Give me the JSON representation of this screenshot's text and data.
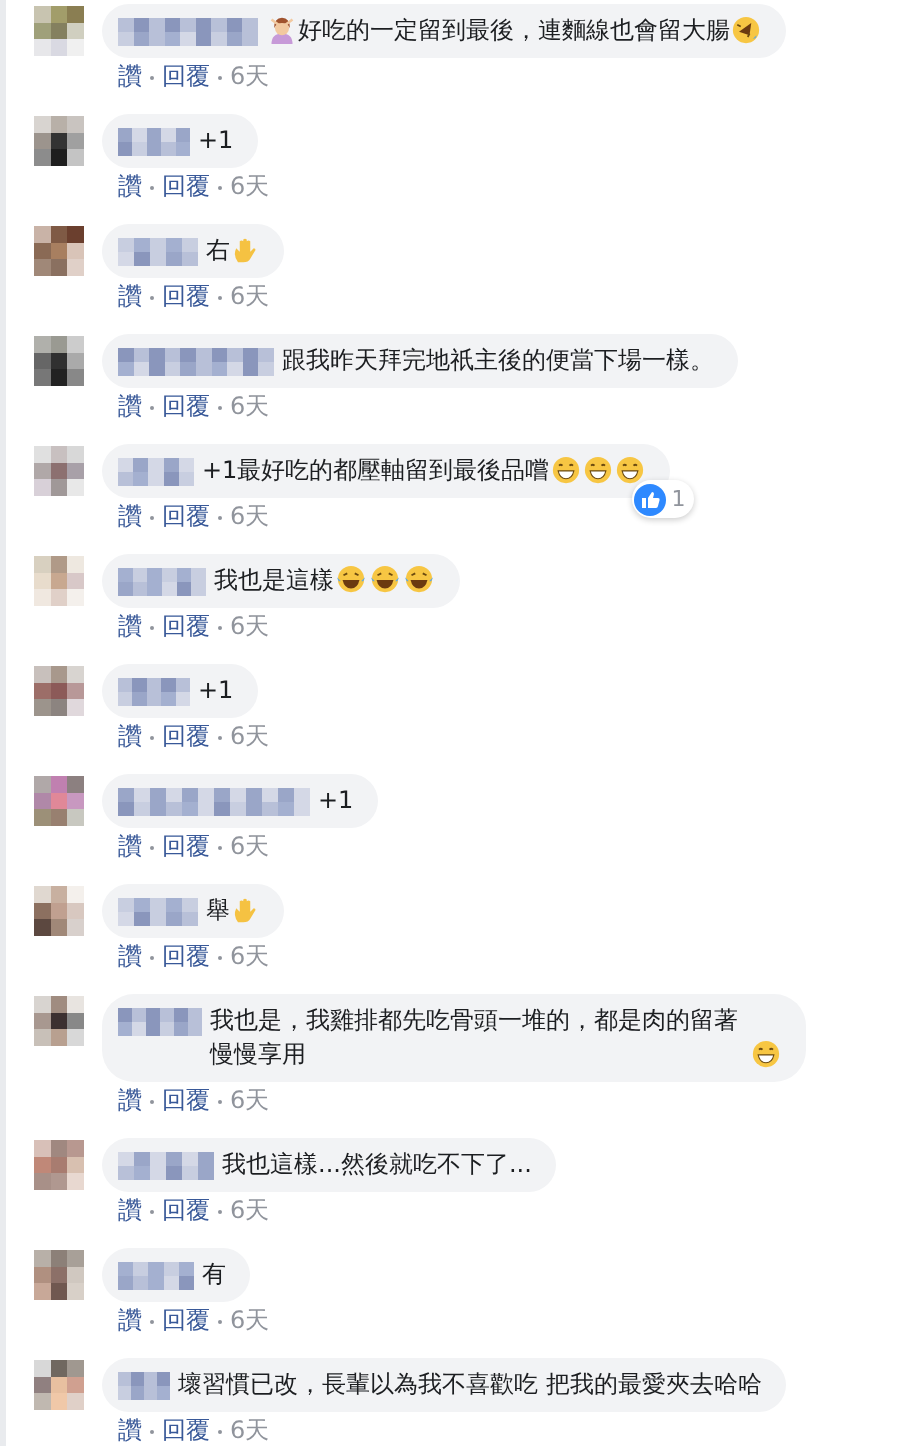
{
  "comments": [
    {
      "parts": [
        {
          "kind": "person"
        },
        {
          "kind": "text",
          "text": "好吃的一定留到最後，連麵線也會留大腸"
        },
        {
          "kind": "rofl"
        }
      ],
      "actions": {
        "like": "讚",
        "reply": "回覆",
        "time": "6天"
      }
    },
    {
      "parts": [
        {
          "kind": "text",
          "text": "+1"
        }
      ],
      "actions": {
        "like": "讚",
        "reply": "回覆",
        "time": "6天"
      }
    },
    {
      "parts": [
        {
          "kind": "text",
          "text": "右"
        },
        {
          "kind": "hand"
        }
      ],
      "actions": {
        "like": "讚",
        "reply": "回覆",
        "time": "6天"
      }
    },
    {
      "parts": [
        {
          "kind": "text",
          "text": "跟我昨天拜完地祇主後的便當下場一樣。"
        }
      ],
      "actions": {
        "like": "讚",
        "reply": "回覆",
        "time": "6天"
      }
    },
    {
      "parts": [
        {
          "kind": "text",
          "text": "+1最好吃的都壓軸留到最後品嚐"
        },
        {
          "kind": "grin"
        },
        {
          "kind": "grin"
        },
        {
          "kind": "grin"
        }
      ],
      "reactions": "1",
      "actions": {
        "like": "讚",
        "reply": "回覆",
        "time": "6天"
      }
    },
    {
      "parts": [
        {
          "kind": "text",
          "text": "我也是這樣"
        },
        {
          "kind": "tears"
        },
        {
          "kind": "tears"
        },
        {
          "kind": "tears"
        }
      ],
      "actions": {
        "like": "讚",
        "reply": "回覆",
        "time": "6天"
      }
    },
    {
      "parts": [
        {
          "kind": "text",
          "text": "+1"
        }
      ],
      "actions": {
        "like": "讚",
        "reply": "回覆",
        "time": "6天"
      }
    },
    {
      "parts": [
        {
          "kind": "text",
          "text": "+1"
        }
      ],
      "actions": {
        "like": "讚",
        "reply": "回覆",
        "time": "6天"
      }
    },
    {
      "parts": [
        {
          "kind": "text",
          "text": "舉"
        },
        {
          "kind": "hand"
        }
      ],
      "actions": {
        "like": "讚",
        "reply": "回覆",
        "time": "6天"
      }
    },
    {
      "parts": [
        {
          "kind": "text",
          "text": "我也是，我雞排都先吃骨頭一堆的，都是肉的留著慢慢享用"
        },
        {
          "kind": "grin"
        }
      ],
      "actions": {
        "like": "讚",
        "reply": "回覆",
        "time": "6天"
      }
    },
    {
      "parts": [
        {
          "kind": "text",
          "text": "我也這樣...然後就吃不下了..."
        }
      ],
      "actions": {
        "like": "讚",
        "reply": "回覆",
        "time": "6天"
      }
    },
    {
      "parts": [
        {
          "kind": "text",
          "text": "有"
        }
      ],
      "actions": {
        "like": "讚",
        "reply": "回覆",
        "time": "6天"
      }
    },
    {
      "parts": [
        {
          "kind": "text",
          "text": "壞習慣已改，長輩以為我不喜歡吃 把我的最愛夾去哈哈"
        }
      ],
      "actions": {
        "like": "讚",
        "reply": "回覆",
        "time": "6天"
      }
    }
  ]
}
